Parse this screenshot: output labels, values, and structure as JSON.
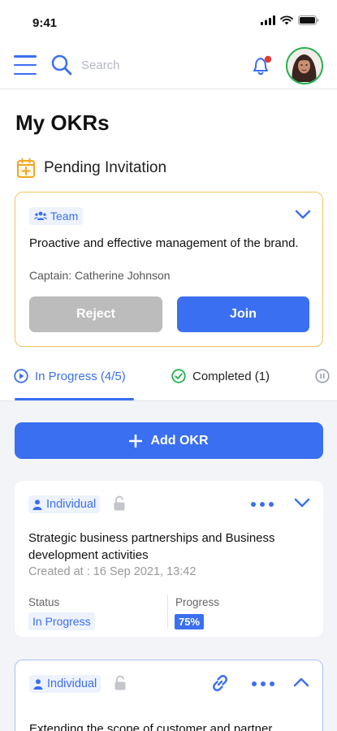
{
  "status_bar": {
    "time": "9:41"
  },
  "header": {
    "search_placeholder": "Search"
  },
  "page": {
    "title": "My OKRs"
  },
  "pending": {
    "title": "Pending Invitation",
    "card": {
      "chip": "Team",
      "title": "Proactive and effective management of the brand.",
      "captain": "Captain: Catherine Johnson",
      "reject_label": "Reject",
      "join_label": "Join"
    }
  },
  "tabs": [
    {
      "label": "In Progress (4/5)",
      "active": true
    },
    {
      "label": "Completed (1)",
      "active": false
    }
  ],
  "add_okr_label": "Add OKR",
  "okrs": [
    {
      "type": "Individual",
      "title": "Strategic business partnerships and Business development activities",
      "created": "Created at : 16 Sep 2021, 13:42",
      "status_label": "Status",
      "status": "In Progress",
      "progress_label": "Progress",
      "progress": "75%"
    },
    {
      "type": "Individual",
      "title": "Extending the scope of customer and partner"
    }
  ],
  "colors": {
    "accent": "#3a6ff2",
    "pending_border": "#f5c45e",
    "online": "#22b24c",
    "notification": "#e53935"
  }
}
